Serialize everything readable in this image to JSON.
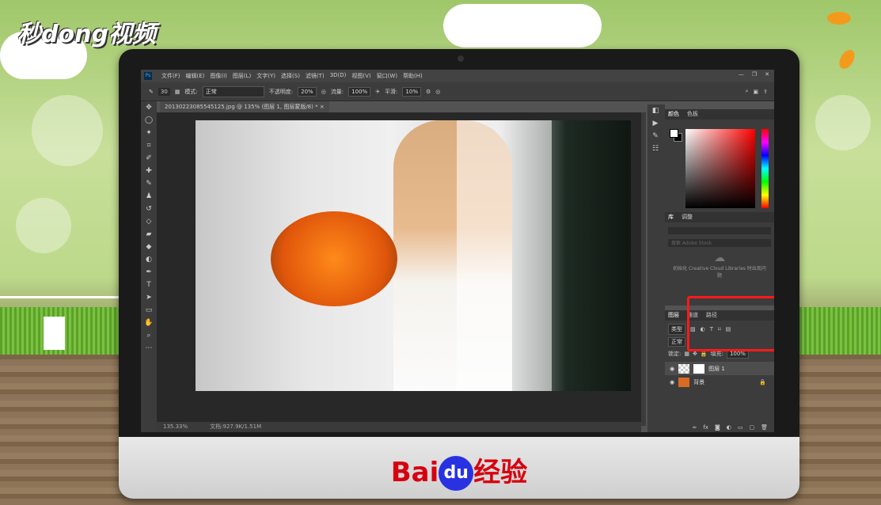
{
  "watermark": {
    "brand": "秒dong视频"
  },
  "bottom_logo": {
    "prefix": "Bai",
    "du": "du",
    "suffix": "经验"
  },
  "photoshop": {
    "app_icon": "Ps",
    "menu": [
      "文件(F)",
      "编辑(E)",
      "图像(I)",
      "图层(L)",
      "文字(Y)",
      "选择(S)",
      "滤镜(T)",
      "3D(D)",
      "视图(V)",
      "窗口(W)",
      "帮助(H)"
    ],
    "options": {
      "brush_size": "30",
      "mode_label": "模式:",
      "mode_value": "正常",
      "opacity_label": "不透明度:",
      "opacity_value": "20%",
      "flow_label": "流量:",
      "flow_value": "100%",
      "smooth_label": "平滑:",
      "smooth_value": "10%"
    },
    "document_tab": "20130223085545125.jpg @ 135% (图层 1, 图层蒙版/8) *",
    "status": {
      "zoom": "135.33%",
      "doc": "文档:927.9K/1.51M"
    },
    "color_panel": {
      "tabs": [
        "颜色",
        "色板"
      ]
    },
    "library_panel": {
      "tabs": [
        "库",
        "调整"
      ],
      "search_placeholder": "搜索 Adobe Stock",
      "message": "初始化 Creative Cloud Libraries 时出现问题"
    },
    "layers_panel": {
      "tabs": [
        "图层",
        "通道",
        "路径"
      ],
      "filter_label": "类型",
      "blend_mode": "正常",
      "lock_label": "锁定:",
      "fill_label": "填充:",
      "fill_value": "100%",
      "layers": [
        {
          "name": "图层 1"
        },
        {
          "name": "背景"
        }
      ]
    }
  },
  "colors": {
    "highlight": "#ff1a1a",
    "baidu_red": "#d7000f",
    "baidu_blue": "#2932e1"
  }
}
